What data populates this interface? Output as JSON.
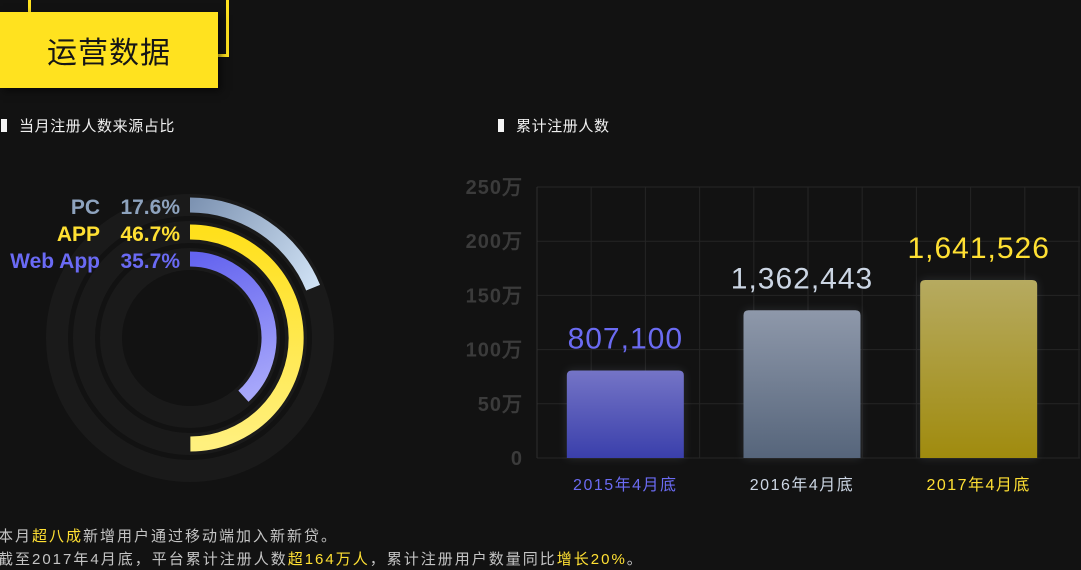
{
  "page": {
    "background": "#121212",
    "accent": "#ffe21f"
  },
  "header": {
    "title": "运营数据"
  },
  "summary": {
    "text_color": "#c4c4c4",
    "highlight_color": "#ffe033",
    "line1": [
      {
        "text": "本月"
      },
      {
        "text": "超八成"
      },
      {
        "text": "新增用户通过移动端加入新新贷。"
      }
    ],
    "line2": [
      {
        "text": "截至2017年4月底，平台累计注册人数"
      },
      {
        "text": "超164万人"
      },
      {
        "text": "，累计注册用户数量同比"
      },
      {
        "text": "增长20%"
      },
      {
        "text": "。"
      }
    ]
  },
  "chart_data": [
    {
      "type": "bar",
      "layout": "radial",
      "title": "当月注册人数来源占比",
      "categories": [
        "PC",
        "APP",
        "Web App"
      ],
      "values": [
        17.6,
        46.7,
        35.7
      ],
      "value_labels": [
        "17.6%",
        "46.7%",
        "35.7%"
      ],
      "track_color": "#1a1a1a",
      "colors": [
        {
          "label": "#8ea3be",
          "arc_start": "#7d93b2",
          "arc_end": "#cfe1f4"
        },
        {
          "label": "#ffe033",
          "arc_start": "#ffe01c",
          "arc_end": "#fff07e"
        },
        {
          "label": "#6a6af4",
          "arc_start": "#6464ef",
          "arc_end": "#a7a7fa"
        }
      ]
    },
    {
      "type": "bar",
      "title": "累计注册人数",
      "categories": [
        "2015年4月底",
        "2016年4月底",
        "2017年4月底"
      ],
      "values": [
        807100,
        1362443,
        1641526
      ],
      "data_labels": [
        "807,100",
        "1,362,443",
        "1,641,526"
      ],
      "ylim": [
        0,
        2500000
      ],
      "yticks": [
        {
          "value": 0,
          "label": "0"
        },
        {
          "value": 500000,
          "label": "50万"
        },
        {
          "value": 1000000,
          "label": "100万"
        },
        {
          "value": 1500000,
          "label": "150万"
        },
        {
          "value": 2000000,
          "label": "200万"
        },
        {
          "value": 2500000,
          "label": "250万"
        }
      ],
      "grid": true,
      "tick_label_color": "#3b3b3b",
      "grid_color": "#252525",
      "colors": [
        {
          "label": "#6b6bf2",
          "bar_top": "#7474c6",
          "bar_bottom": "#3a3fab"
        },
        {
          "label": "#ccd6e4",
          "bar_top": "#8e98aa",
          "bar_bottom": "#56657b"
        },
        {
          "label": "#ffe033",
          "bar_top": "#b6aa60",
          "bar_bottom": "#a08b0e"
        }
      ]
    }
  ]
}
